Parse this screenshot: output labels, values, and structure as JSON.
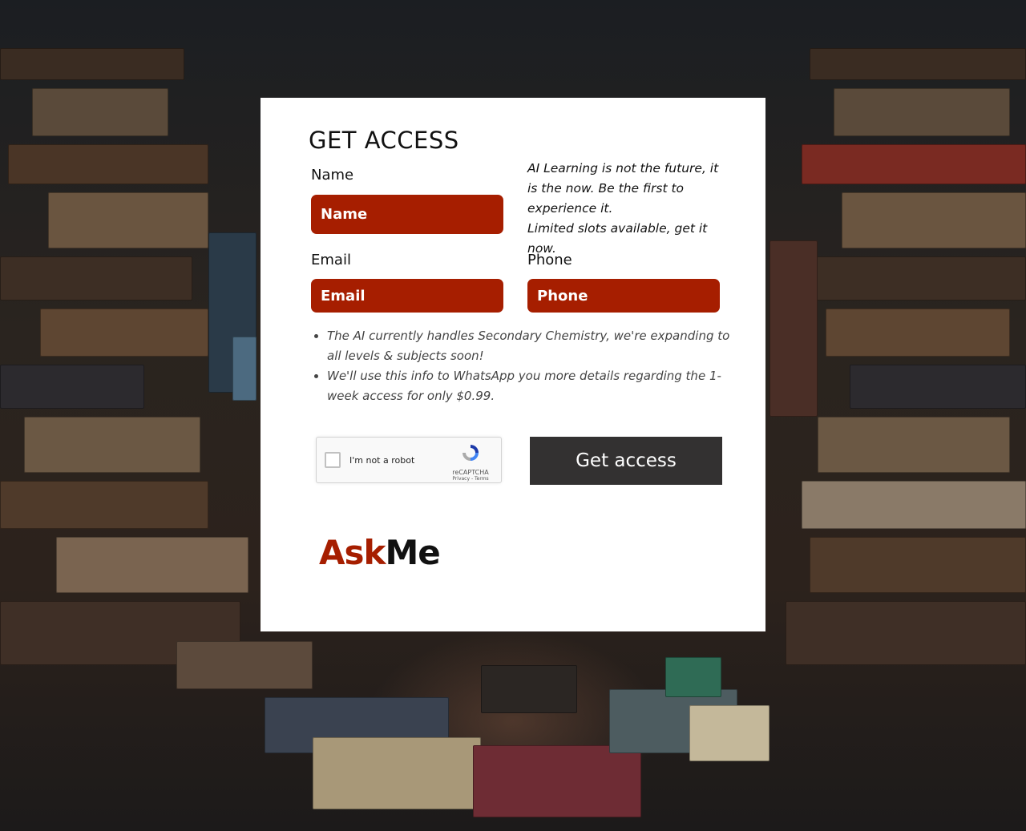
{
  "form": {
    "title": "GET ACCESS",
    "name_label": "Name",
    "name_placeholder": "Name",
    "email_label": "Email",
    "email_placeholder": "Email",
    "phone_label": "Phone",
    "phone_placeholder": "Phone",
    "intro_line1": "AI Learning is not the future, it is the now. Be the first to experience it.",
    "intro_line2": "Limited slots available, get it now.",
    "notes": [
      "The AI currently handles Secondary Chemistry, we're expanding to all levels & subjects soon!",
      "We'll use this info to WhatsApp you more details regarding the 1-week access for only $0.99."
    ],
    "submit_label": "Get access"
  },
  "captcha": {
    "label": "I'm not a robot",
    "brand": "reCAPTCHA",
    "links": "Privacy - Terms"
  },
  "brand": {
    "part1": "Ask",
    "part2": "Me"
  },
  "colors": {
    "accent": "#a61e00",
    "button": "#333131",
    "card": "#ffffff"
  }
}
